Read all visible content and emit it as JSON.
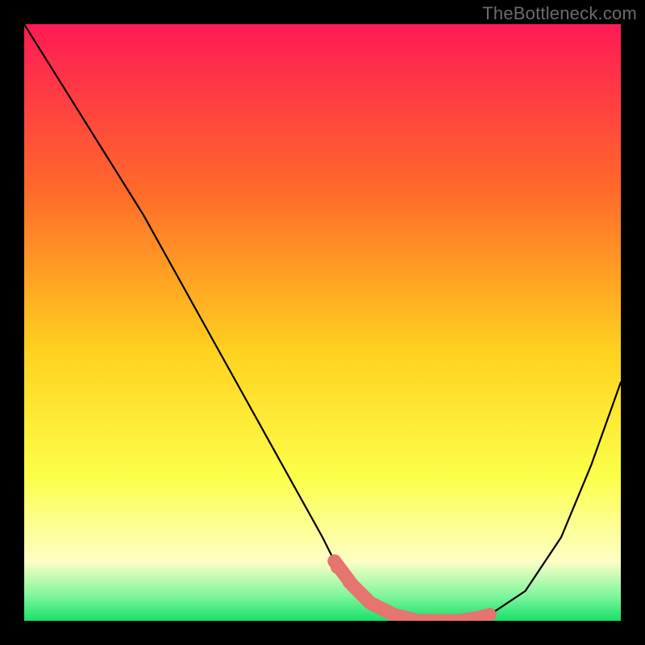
{
  "watermark": "TheBottleneck.com",
  "colors": {
    "page_bg": "#000000",
    "grad_top": "#ff1a55",
    "grad_mid1": "#ff6a2a",
    "grad_mid2": "#ffd21f",
    "grad_mid3": "#fcff4a",
    "grad_pale": "#fdffc5",
    "grad_green_light": "#7af59a",
    "grad_green": "#18e06a",
    "curve_stroke": "#000000",
    "highlight": "#e6746f"
  },
  "chart_data": {
    "type": "line",
    "title": "",
    "xlabel": "",
    "ylabel": "",
    "xlim": [
      0,
      100
    ],
    "ylim": [
      0,
      100
    ],
    "series": [
      {
        "name": "bottleneck-curve",
        "x": [
          0,
          5,
          10,
          15,
          20,
          25,
          30,
          35,
          40,
          45,
          50,
          52,
          55,
          58,
          62,
          66,
          70,
          73,
          78,
          84,
          90,
          95,
          100
        ],
        "y": [
          100,
          92,
          84,
          76,
          68,
          59,
          50,
          41,
          32,
          23,
          14,
          10,
          6,
          3,
          1,
          0,
          0,
          0,
          1,
          5,
          14,
          26,
          40
        ]
      }
    ],
    "highlight_segment": {
      "name": "optimal-range",
      "x": [
        52,
        55,
        58,
        62,
        66,
        70,
        73,
        76,
        78
      ],
      "y": [
        10,
        6,
        3,
        1,
        0,
        0,
        0,
        0.5,
        1
      ]
    },
    "highlight_dots": {
      "x": [
        52.5,
        54.5
      ],
      "y": [
        9,
        6.5
      ]
    }
  }
}
